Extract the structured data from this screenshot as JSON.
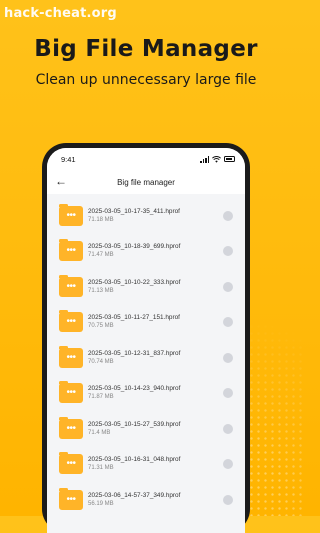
{
  "watermark": "hack-cheat.org",
  "promo": {
    "title": "Big File Manager",
    "subtitle": "Clean up unnecessary large file"
  },
  "status_bar": {
    "time": "9:41"
  },
  "app": {
    "title": "Big file manager"
  },
  "files": [
    {
      "name": "2025-03-05_10-17-35_411.hprof",
      "size": "71.18 MB"
    },
    {
      "name": "2025-03-05_10-18-39_699.hprof",
      "size": "71.47 MB"
    },
    {
      "name": "2025-03-05_10-10-22_333.hprof",
      "size": "71.13 MB"
    },
    {
      "name": "2025-03-05_10-11-27_151.hprof",
      "size": "70.75 MB"
    },
    {
      "name": "2025-03-05_10-12-31_837.hprof",
      "size": "70.74 MB"
    },
    {
      "name": "2025-03-05_10-14-23_940.hprof",
      "size": "71.87 MB"
    },
    {
      "name": "2025-03-05_10-15-27_539.hprof",
      "size": "71.4 MB"
    },
    {
      "name": "2025-03-05_10-16-31_048.hprof",
      "size": "71.31 MB"
    },
    {
      "name": "2025-03-06_14-57-37_349.hprof",
      "size": "56.19 MB"
    }
  ],
  "colors": {
    "background": "#FFBB10",
    "folder": "#FFB428"
  },
  "icons": {
    "back": "back-arrow-icon",
    "file": "folder-icon",
    "select": "radio-unchecked-icon"
  }
}
